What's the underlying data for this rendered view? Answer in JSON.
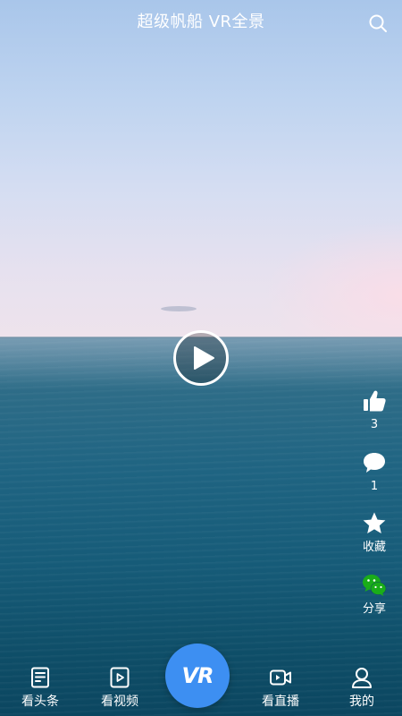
{
  "header": {
    "title": "超级帆船 VR全景",
    "search_icon": "search-icon"
  },
  "player": {
    "play_icon": "play-icon"
  },
  "actions": [
    {
      "icon": "thumbs-up-icon",
      "label": "3"
    },
    {
      "icon": "comment-icon",
      "label": "1"
    },
    {
      "icon": "star-icon",
      "label": "收藏"
    },
    {
      "icon": "wechat-icon",
      "label": "分享"
    }
  ],
  "bottom_nav": {
    "items": [
      {
        "icon": "news-icon",
        "label": "看头条"
      },
      {
        "icon": "video-icon",
        "label": "看视频"
      },
      {
        "icon": "live-camera-icon",
        "label": "看直播"
      },
      {
        "icon": "user-icon",
        "label": "我的"
      }
    ],
    "center_button": {
      "label": "VR"
    }
  },
  "colors": {
    "accent": "#3d8ff2",
    "wechat_green": "#1aad19",
    "text": "#ffffff"
  }
}
